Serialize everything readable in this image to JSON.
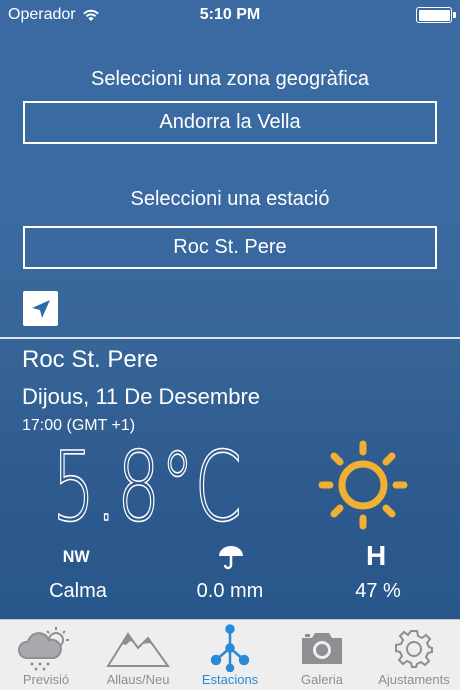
{
  "status_bar": {
    "carrier": "Operador",
    "time": "5:10 PM"
  },
  "zone": {
    "label": "Seleccioni una zona geogràfica",
    "value": "Andorra la Vella"
  },
  "station": {
    "label": "Seleccioni una estació",
    "value": "Roc St. Pere"
  },
  "current": {
    "station_name": "Roc St. Pere",
    "date": "Dijous, 11 De Desembre",
    "time": "17:00 (GMT +1)",
    "temperature": "5.8°C",
    "condition_icon": "sun-icon"
  },
  "metrics": {
    "wind_direction": "NW",
    "wind_value": "Calma",
    "precip_value": "0.0 mm",
    "humidity_label": "H",
    "humidity_value": "47 %"
  },
  "tabs": [
    {
      "label": "Previsió",
      "icon": "weather-icon",
      "active": false
    },
    {
      "label": "Allaus/Neu",
      "icon": "mountain-icon",
      "active": false
    },
    {
      "label": "Estacions",
      "icon": "stations-icon",
      "active": true
    },
    {
      "label": "Galeria",
      "icon": "camera-icon",
      "active": false
    },
    {
      "label": "Ajustaments",
      "icon": "gear-icon",
      "active": false
    }
  ],
  "colors": {
    "accent": "#2a8ad6",
    "sun": "#f0b032",
    "background": "#3a6aa1"
  }
}
